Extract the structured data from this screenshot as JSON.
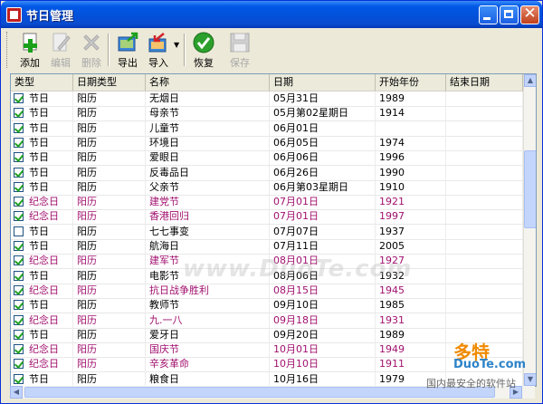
{
  "window": {
    "title": "节日管理"
  },
  "toolbar": {
    "add": "添加",
    "edit": "编辑",
    "delete": "删除",
    "export": "导出",
    "import": "导入",
    "restore": "恢复",
    "save": "保存"
  },
  "columns": [
    "类型",
    "日期类型",
    "名称",
    "日期",
    "开始年份",
    "结束日期"
  ],
  "rows": [
    {
      "checked": true,
      "type": "节日",
      "datetype": "阳历",
      "name": "无烟日",
      "date": "05月31日",
      "start": "1989",
      "end": "",
      "special": false
    },
    {
      "checked": true,
      "type": "节日",
      "datetype": "阳历",
      "name": "母亲节",
      "date": "05月第02星期日",
      "start": "1914",
      "end": "",
      "special": false
    },
    {
      "checked": true,
      "type": "节日",
      "datetype": "阳历",
      "name": "儿童节",
      "date": "06月01日",
      "start": "",
      "end": "",
      "special": false
    },
    {
      "checked": true,
      "type": "节日",
      "datetype": "阳历",
      "name": "环境日",
      "date": "06月05日",
      "start": "1974",
      "end": "",
      "special": false
    },
    {
      "checked": true,
      "type": "节日",
      "datetype": "阳历",
      "name": "爱眼日",
      "date": "06月06日",
      "start": "1996",
      "end": "",
      "special": false
    },
    {
      "checked": true,
      "type": "节日",
      "datetype": "阳历",
      "name": "反毒品日",
      "date": "06月26日",
      "start": "1990",
      "end": "",
      "special": false
    },
    {
      "checked": true,
      "type": "节日",
      "datetype": "阳历",
      "name": "父亲节",
      "date": "06月第03星期日",
      "start": "1910",
      "end": "",
      "special": false
    },
    {
      "checked": true,
      "type": "纪念日",
      "datetype": "阳历",
      "name": "建党节",
      "date": "07月01日",
      "start": "1921",
      "end": "",
      "special": true
    },
    {
      "checked": true,
      "type": "纪念日",
      "datetype": "阳历",
      "name": "香港回归",
      "date": "07月01日",
      "start": "1997",
      "end": "",
      "special": true
    },
    {
      "checked": false,
      "type": "节日",
      "datetype": "阳历",
      "name": "七七事变",
      "date": "07月07日",
      "start": "1937",
      "end": "",
      "special": false
    },
    {
      "checked": true,
      "type": "节日",
      "datetype": "阳历",
      "name": "航海日",
      "date": "07月11日",
      "start": "2005",
      "end": "",
      "special": false
    },
    {
      "checked": true,
      "type": "纪念日",
      "datetype": "阳历",
      "name": "建军节",
      "date": "08月01日",
      "start": "1927",
      "end": "",
      "special": true
    },
    {
      "checked": true,
      "type": "节日",
      "datetype": "阳历",
      "name": "电影节",
      "date": "08月06日",
      "start": "1932",
      "end": "",
      "special": false
    },
    {
      "checked": true,
      "type": "纪念日",
      "datetype": "阳历",
      "name": "抗日战争胜利",
      "date": "08月15日",
      "start": "1945",
      "end": "",
      "special": true
    },
    {
      "checked": true,
      "type": "节日",
      "datetype": "阳历",
      "name": "教师节",
      "date": "09月10日",
      "start": "1985",
      "end": "",
      "special": false
    },
    {
      "checked": true,
      "type": "纪念日",
      "datetype": "阳历",
      "name": "九.一八",
      "date": "09月18日",
      "start": "1931",
      "end": "",
      "special": true
    },
    {
      "checked": true,
      "type": "节日",
      "datetype": "阳历",
      "name": "爱牙日",
      "date": "09月20日",
      "start": "1989",
      "end": "",
      "special": false
    },
    {
      "checked": true,
      "type": "纪念日",
      "datetype": "阳历",
      "name": "国庆节",
      "date": "10月01日",
      "start": "1949",
      "end": "",
      "special": true
    },
    {
      "checked": true,
      "type": "纪念日",
      "datetype": "阳历",
      "name": "辛亥革命",
      "date": "10月10日",
      "start": "1911",
      "end": "",
      "special": true
    },
    {
      "checked": true,
      "type": "节日",
      "datetype": "阳历",
      "name": "粮食日",
      "date": "10月16日",
      "start": "1979",
      "end": "",
      "special": false
    }
  ],
  "watermark": "www.DuoTe.com",
  "badge": {
    "title": "多特",
    "subtitle": "软件站",
    "domain": "DuoTe.com",
    "footer": "国内最安全的软件站"
  },
  "colors": {
    "special_row": "#a1106e",
    "titlebar": "#0058e6"
  }
}
